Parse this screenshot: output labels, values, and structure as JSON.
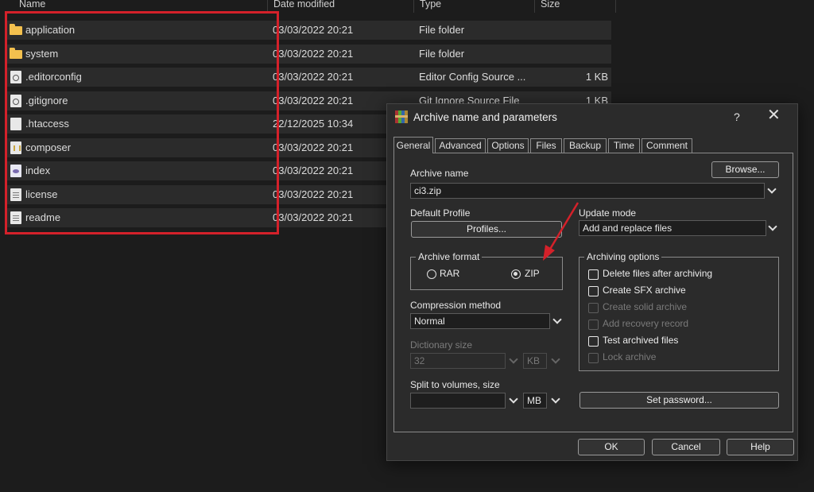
{
  "explorer": {
    "columns": [
      "Name",
      "Date modified",
      "Type",
      "Size"
    ],
    "rows": [
      {
        "name": "application",
        "date": "03/03/2022 20:21",
        "type": "File folder",
        "size": "",
        "icon": "folder-icon"
      },
      {
        "name": "system",
        "date": "03/03/2022 20:21",
        "type": "File folder",
        "size": "",
        "icon": "folder-icon"
      },
      {
        "name": ".editorconfig",
        "date": "03/03/2022 20:21",
        "type": "Editor Config Source ...",
        "size": "1 KB",
        "icon": "config-file-icon"
      },
      {
        "name": ".gitignore",
        "date": "03/03/2022 20:21",
        "type": "Git Ignore Source File",
        "size": "1 KB",
        "icon": "config-file-icon"
      },
      {
        "name": ".htaccess",
        "date": "22/12/2025 10:34",
        "type": "",
        "size": "",
        "icon": "file-icon"
      },
      {
        "name": "composer",
        "date": "03/03/2022 20:21",
        "type": "",
        "size": "",
        "icon": "json-file-icon"
      },
      {
        "name": "index",
        "date": "03/03/2022 20:21",
        "type": "",
        "size": "",
        "icon": "php-file-icon"
      },
      {
        "name": "license",
        "date": "03/03/2022 20:21",
        "type": "",
        "size": "",
        "icon": "text-file-icon"
      },
      {
        "name": "readme",
        "date": "03/03/2022 20:21",
        "type": "",
        "size": "",
        "icon": "text-file-icon"
      }
    ],
    "highlight_color": "#d4212a"
  },
  "dialog": {
    "title": "Archive name and parameters",
    "help": "?",
    "close": "✕",
    "tabs": [
      "General",
      "Advanced",
      "Options",
      "Files",
      "Backup",
      "Time",
      "Comment"
    ],
    "active_tab": "General",
    "archive_name_label": "Archive name",
    "archive_name_value": "ci3.zip",
    "browse_label": "Browse...",
    "default_profile_label": "Default Profile",
    "profiles_label": "Profiles...",
    "update_mode_label": "Update mode",
    "update_mode_value": "Add and replace files",
    "archive_format_label": "Archive format",
    "format_rar": "RAR",
    "format_zip": "ZIP",
    "selected_format": "ZIP",
    "compression_method_label": "Compression method",
    "compression_method_value": "Normal",
    "dictionary_size_label": "Dictionary size",
    "dictionary_size_value": "32",
    "dictionary_unit": "KB",
    "split_label": "Split to volumes, size",
    "split_value": "",
    "split_unit": "MB",
    "archiving_options_label": "Archiving options",
    "options": [
      {
        "label": "Delete files after archiving",
        "enabled": true,
        "checked": false
      },
      {
        "label": "Create SFX archive",
        "enabled": true,
        "checked": false
      },
      {
        "label": "Create solid archive",
        "enabled": false,
        "checked": false
      },
      {
        "label": "Add recovery record",
        "enabled": false,
        "checked": false
      },
      {
        "label": "Test archived files",
        "enabled": true,
        "checked": false
      },
      {
        "label": "Lock archive",
        "enabled": false,
        "checked": false
      }
    ],
    "set_password_label": "Set password...",
    "ok_label": "OK",
    "cancel_label": "Cancel",
    "help_label": "Help"
  },
  "annotation": {
    "arrow_color": "#d4212a"
  }
}
